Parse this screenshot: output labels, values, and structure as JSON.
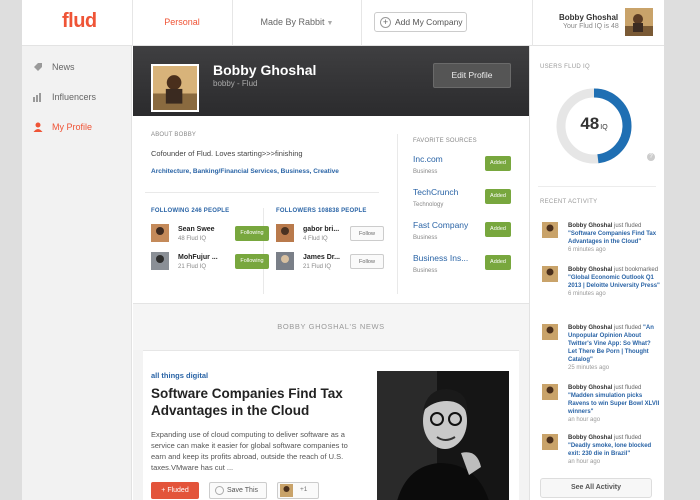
{
  "header": {
    "logo": "flud",
    "tabs": [
      {
        "label": "Personal"
      },
      {
        "label": "Made By Rabbit"
      }
    ],
    "add_company_label": "Add My Company",
    "user": {
      "name": "Bobby Ghoshal",
      "iq": "Your Flud IQ is 48"
    }
  },
  "sidebar": {
    "items": [
      {
        "label": "News"
      },
      {
        "label": "Influencers"
      },
      {
        "label": "My Profile"
      }
    ]
  },
  "profile": {
    "name": "Bobby Ghoshal",
    "handle": "bobby - Flud",
    "edit_label": "Edit Profile",
    "about_caption": "ABOUT BOBBY",
    "bio": "Cofounder of Flud. Loves starting>>>finishing",
    "tags": "Architecture, Banking/Financial Services, Business, Creative",
    "following_caption": "FOLLOWING 246 PEOPLE",
    "followers_caption": "FOLLOWERS 108838 PEOPLE",
    "following": [
      {
        "name": "Sean Swee",
        "iq": "48 Flud IQ",
        "button": "Following"
      },
      {
        "name": "MohFujur ...",
        "iq": "21 Flud IQ",
        "button": "Following"
      }
    ],
    "followers": [
      {
        "name": "gabor bri...",
        "iq": "4 Flud IQ",
        "button": "Follow"
      },
      {
        "name": "James Dr...",
        "iq": "21 Flud IQ",
        "button": "Follow"
      }
    ],
    "sources_caption": "FAVORITE SOURCES",
    "sources": [
      {
        "name": "Inc.com",
        "category": "Business",
        "button": "Added"
      },
      {
        "name": "TechCrunch",
        "category": "Technology",
        "button": "Added"
      },
      {
        "name": "Fast Company",
        "category": "Business",
        "button": "Added"
      },
      {
        "name": "Business Ins...",
        "category": "Business",
        "button": "Added"
      }
    ]
  },
  "news": {
    "header": "BOBBY GHOSHAL'S NEWS",
    "article": {
      "source": "all things digital",
      "title": "Software Companies Find Tax Advantages in the Cloud",
      "body": "Expanding use of cloud computing to deliver software as a service can make it easier for global software companies to earn and keep its profits abroad, outside the reach of U.S. taxes.VMware has cut ...",
      "fluded_label": "Fluded",
      "save_label": "Save This",
      "count": "+1"
    }
  },
  "right": {
    "iq_caption": "USERS FLUD IQ",
    "iq_value": "48",
    "iq_unit": "IQ",
    "iq_fraction": 0.48,
    "activity_caption": "RECENT ACTIVITY",
    "activity": [
      {
        "user": "Bobby Ghoshal",
        "verb": "just fluded",
        "item": "\"Software Companies Find Tax Advantages in the Cloud\"",
        "time": "6 minutes ago"
      },
      {
        "user": "Bobby Ghoshal",
        "verb": "just bookmarked",
        "item": "\"Global Economic Outlook Q1 2013 | Deloitte University Press\"",
        "time": "6 minutes ago"
      },
      {
        "user": "Bobby Ghoshal",
        "verb": "just fluded",
        "item": "\"An Unpopular Opinion About Twitter's Vine App: So What? Let There Be Porn | Thought Catalog\"",
        "time": "25 minutes ago"
      },
      {
        "user": "Bobby Ghoshal",
        "verb": "just fluded",
        "item": "\"Madden simulation picks Ravens to win Super Bowl XLVII winners\"",
        "time": "an hour ago"
      },
      {
        "user": "Bobby Ghoshal",
        "verb": "just fluded",
        "item": "\"Deadly smoke, lone blocked exit: 230 die in Brazil\"",
        "time": "an hour ago"
      }
    ],
    "see_all_label": "See All Activity"
  },
  "colors": {
    "accent": "#ef5436",
    "link": "#2a64a6",
    "added": "#78a73e",
    "gauge": "#1f6fb3"
  }
}
